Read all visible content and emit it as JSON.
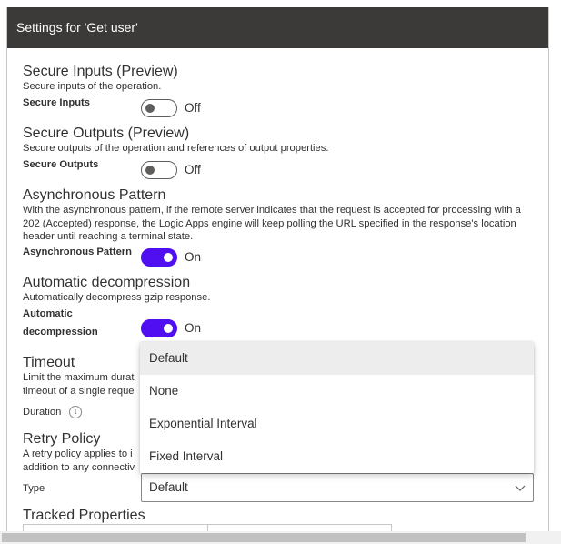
{
  "panel": {
    "title": "Settings for 'Get user'"
  },
  "secure_inputs": {
    "title": "Secure Inputs (Preview)",
    "description": "Secure inputs of the operation.",
    "label": "Secure Inputs",
    "state": "Off"
  },
  "secure_outputs": {
    "title": "Secure Outputs (Preview)",
    "description": "Secure outputs of the operation and references of output properties.",
    "label": "Secure Outputs",
    "state": "Off"
  },
  "async_pattern": {
    "title": "Asynchronous Pattern",
    "description": "With the asynchronous pattern, if the remote server indicates that the request is accepted for processing with a 202 (Accepted) response, the Logic Apps engine will keep polling the URL specified in the response's location header until reaching a terminal state.",
    "label": "Asynchronous Pattern",
    "state": "On"
  },
  "auto_decompression": {
    "title": "Automatic decompression",
    "description": "Automatically decompress gzip response.",
    "label_line1": "Automatic",
    "label_line2": "decompression",
    "state": "On"
  },
  "timeout": {
    "title": "Timeout",
    "description_line1": "Limit the maximum durat",
    "description_line2": "timeout of a single reque",
    "duration_label": "Duration",
    "info_icon": "i"
  },
  "retry_policy": {
    "title": "Retry Policy",
    "description_line1": "A retry policy applies to i",
    "description_line2": "addition to any connectiv",
    "type_label": "Type",
    "selected": "Default",
    "options": [
      "Default",
      "None",
      "Exponential Interval",
      "Fixed Interval"
    ]
  },
  "tracked_properties": {
    "title": "Tracked Properties"
  },
  "colors": {
    "header_bg": "#3b3a39",
    "toggle_on": "#4f0ff0",
    "selected_option_bg": "#ededed"
  }
}
